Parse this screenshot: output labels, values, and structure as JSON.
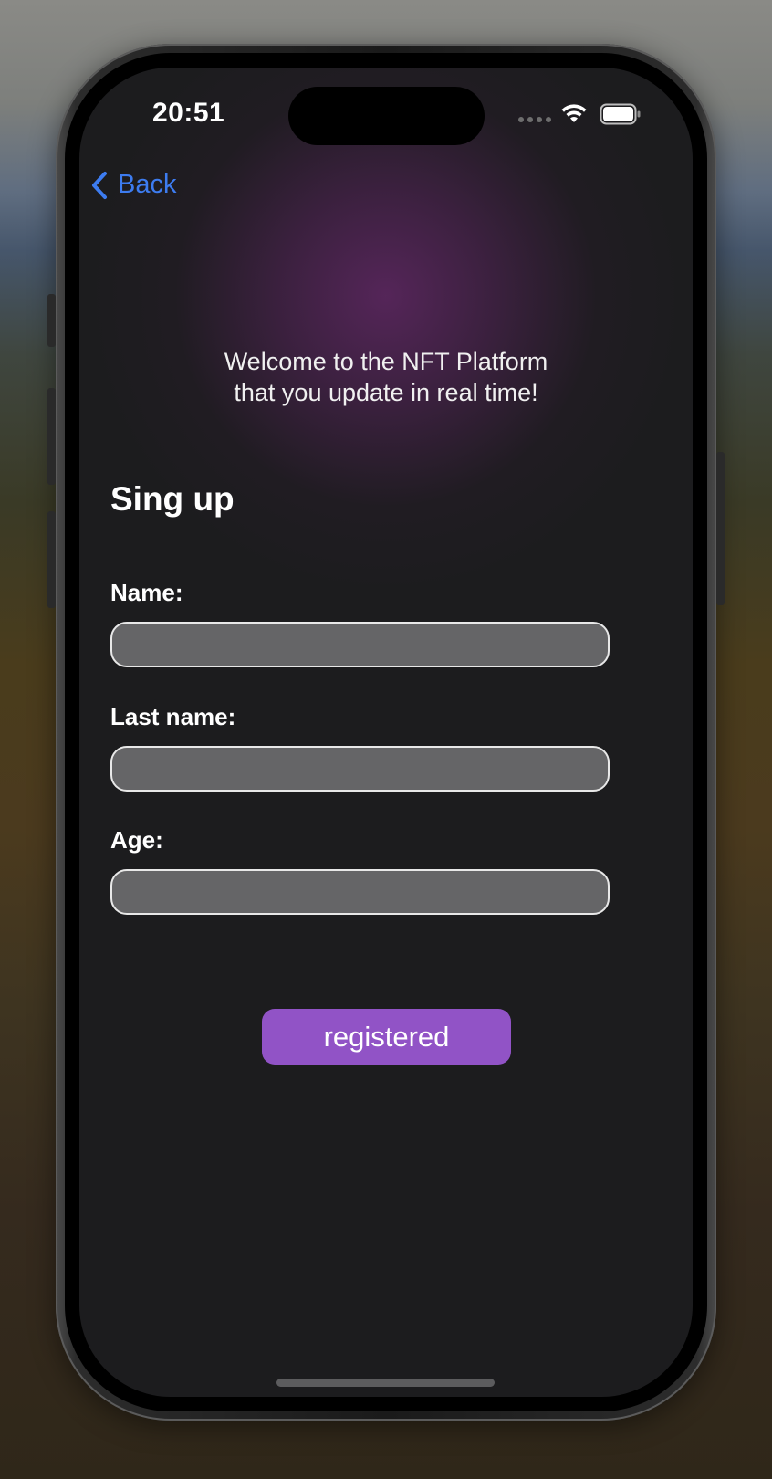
{
  "status_bar": {
    "time": "20:51"
  },
  "nav": {
    "back_label": "Back"
  },
  "welcome": {
    "line1": "Welcome to the NFT Platform",
    "line2": "that you update in real time!"
  },
  "form": {
    "title": "Sing up",
    "fields": [
      {
        "label": "Name:",
        "value": "",
        "placeholder": ""
      },
      {
        "label": "Last name:",
        "value": "",
        "placeholder": ""
      },
      {
        "label": "Age:",
        "value": "",
        "placeholder": ""
      }
    ],
    "submit_label": "registered"
  },
  "icons": {
    "back": "chevron-left-icon",
    "wifi": "wifi-icon",
    "battery": "battery-icon",
    "signal": "cellular-signal-icon"
  },
  "colors": {
    "accent_link": "#3d7cf0",
    "button": "#9153c6",
    "input_fill": "#656567",
    "screen_bg": "#1c1c1e"
  }
}
